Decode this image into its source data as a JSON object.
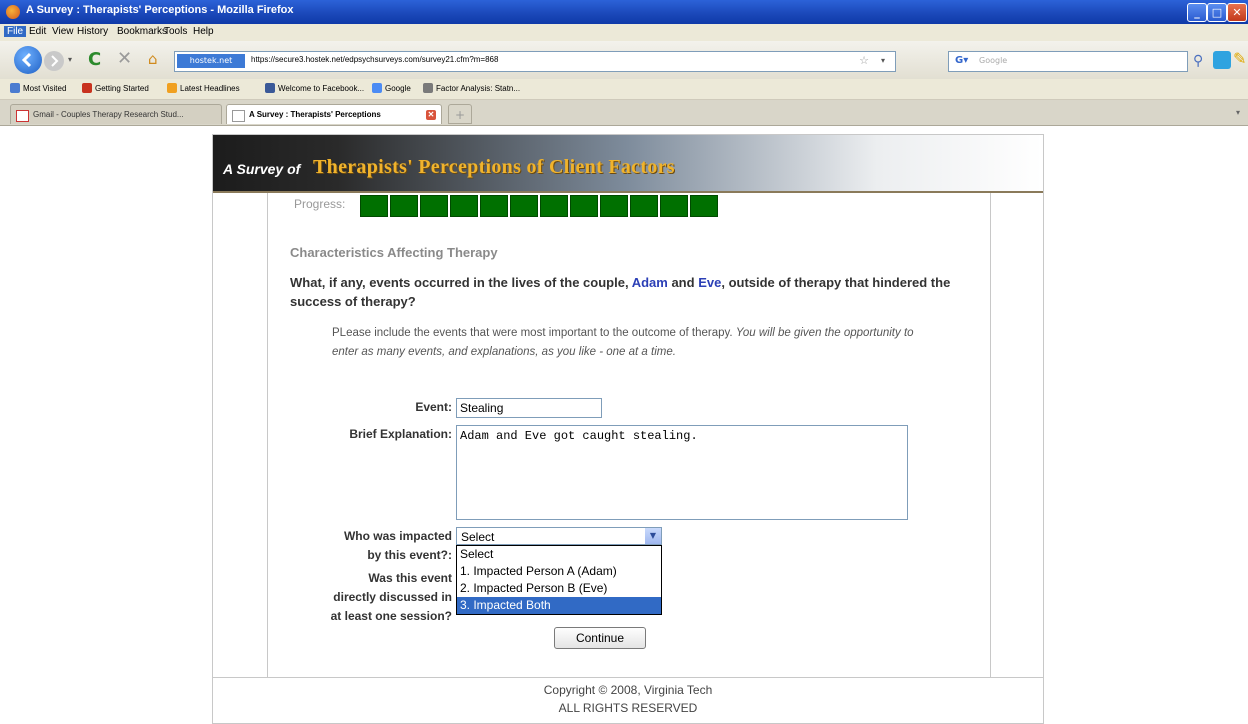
{
  "window": {
    "title": "A Survey : Therapists' Perceptions - Mozilla Firefox"
  },
  "menu": [
    "File",
    "Edit",
    "View",
    "History",
    "Bookmarks",
    "Tools",
    "Help"
  ],
  "nav": {
    "site_label": "hostek.net",
    "url": "https://secure3.hostek.net/edpsychsurveys.com/survey21.cfm?m=868",
    "search_placeholder": "Google"
  },
  "bookmarks": [
    "Most Visited",
    "Getting Started",
    "Latest Headlines",
    "Welcome to Facebook...",
    "Google",
    "Factor Analysis: Statn..."
  ],
  "tabs": [
    {
      "label": "Gmail - Couples Therapy Research Stud...",
      "active": false
    },
    {
      "label": "A Survey : Therapists' Perceptions",
      "active": true
    }
  ],
  "survey": {
    "banner_prefix": "A Survey of",
    "banner_title": "Therapists' Perceptions of Client Factors",
    "progress_label": "Progress:",
    "progress_filled": 12,
    "section_title": "Characteristics Affecting Therapy",
    "question_part1": "What, if any, events occurred in the lives of the couple,",
    "person_a": "Adam",
    "question_and": "and",
    "person_b": "Eve",
    "question_part2": ", outside of therapy that hindered the success of therapy?",
    "instruction_plain": "PLease include the events that were most important to the outcome of therapy.",
    "instruction_italic": "You will be given the opportunity to enter as many events, and explanations, as you like - one at a time.",
    "event_label": "Event:",
    "event_value": "Stealing",
    "explanation_label": "Brief Explanation:",
    "explanation_value": "Adam and Eve got caught stealing.",
    "impacted_label_1": "Who was impacted",
    "impacted_label_2": "by this event?:",
    "impacted_selected": "Select",
    "impacted_options": [
      "Select",
      "1. Impacted Person A (Adam)",
      "2. Impacted Person B (Eve)",
      "3. Impacted Both"
    ],
    "impacted_highlighted": 3,
    "discussed_label_1": "Was this event",
    "discussed_label_2": "directly discussed in",
    "discussed_label_3": "at least one session?",
    "continue_label": "Continue"
  },
  "footer": {
    "copyright": "Copyright © 2008, Virginia Tech",
    "rights": "ALL RIGHTS RESERVED"
  }
}
